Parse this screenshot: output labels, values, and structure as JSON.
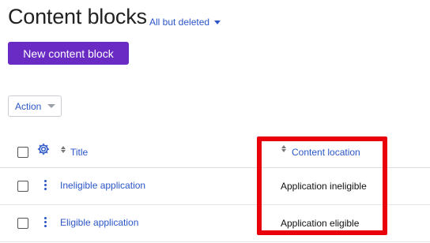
{
  "header": {
    "title": "Content blocks",
    "filter_label": "All but deleted"
  },
  "toolbar": {
    "new_button_label": "New content block",
    "action_label": "Action"
  },
  "table": {
    "columns": {
      "title": "Title",
      "location": "Content location"
    },
    "rows": [
      {
        "title": "Ineligible application",
        "location": "Application ineligible"
      },
      {
        "title": "Eligible application",
        "location": "Application eligible"
      }
    ]
  },
  "colors": {
    "accent": "#6a2bc4",
    "link": "#2b56c8",
    "highlight": "#e8000b"
  },
  "icons": {
    "settings": "gear-icon",
    "row_menu": "kebab-menu-icon",
    "sort": "sort-icon",
    "dropdown": "chevron-down-icon"
  }
}
